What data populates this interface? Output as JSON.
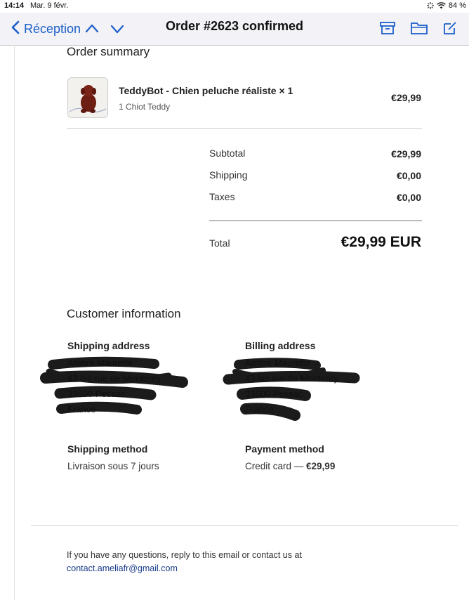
{
  "status_bar": {
    "time": "14:14",
    "date": "Mar. 9 févr.",
    "battery": "84 %"
  },
  "nav": {
    "back_label": "Réception",
    "title": "Order #2623 confirmed"
  },
  "order_summary": {
    "heading": "Order summary",
    "item": {
      "title": "TeddyBot - Chien peluche réaliste × 1",
      "variant": "1 Chiot Teddy",
      "price": "€29,99"
    },
    "rows": [
      {
        "label": "Subtotal",
        "value": "€29,99"
      },
      {
        "label": "Shipping",
        "value": "€0,00"
      },
      {
        "label": "Taxes",
        "value": "€0,00"
      }
    ],
    "total_label": "Total",
    "total_value": "€29,99 EUR"
  },
  "customer": {
    "heading": "Customer information",
    "shipping_address": {
      "label": "Shipping address",
      "lines": [
        "Ambre Maurette",
        "43 bis rue de Monterey",
        "33600 Pessac",
        "France"
      ]
    },
    "billing_address": {
      "label": "Billing address",
      "lines": [
        "Ambre Maurette",
        "43 bis rue de Monterey",
        "33600 Pessac",
        "France"
      ]
    },
    "shipping_method": {
      "label": "Shipping method",
      "value": "Livraison sous 7 jours"
    },
    "payment_method": {
      "label": "Payment method",
      "value_prefix": "Credit card — ",
      "value_amount": "€29,99"
    }
  },
  "footer": {
    "text": "If you have any questions, reply to this email or contact us at",
    "email": "contact.ameliafr@gmail.com"
  },
  "colors": {
    "accent": "#1a5ec9",
    "link": "#1a3c8a",
    "redaction": "#0a0a0a"
  }
}
